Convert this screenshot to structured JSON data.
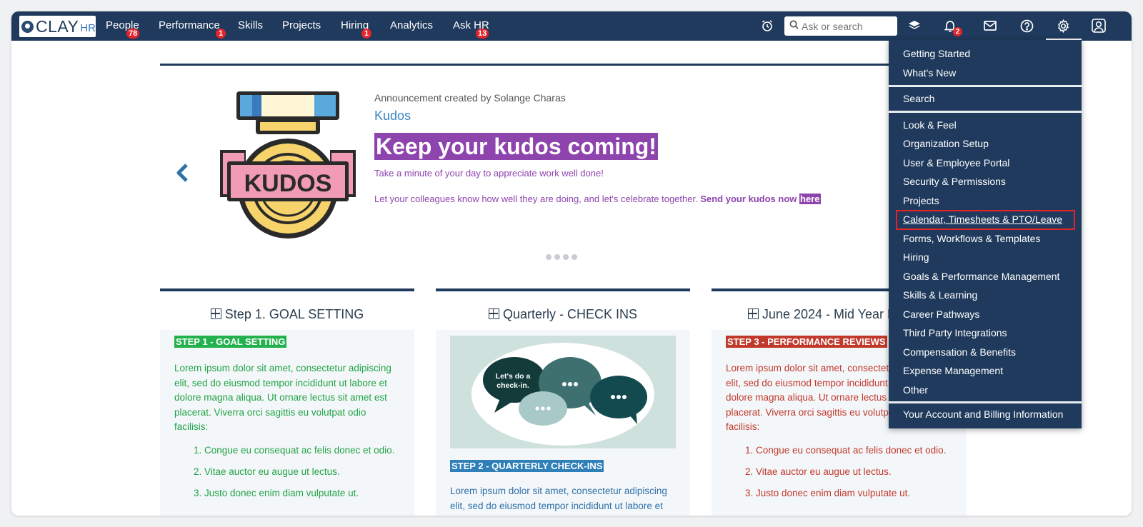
{
  "app": {
    "logo_text": "CLAY",
    "logo_suffix": "HR"
  },
  "nav": {
    "items": [
      {
        "label": "People",
        "badge": "78"
      },
      {
        "label": "Performance",
        "badge": "1"
      },
      {
        "label": "Skills",
        "badge": ""
      },
      {
        "label": "Projects",
        "badge": ""
      },
      {
        "label": "Hiring",
        "badge": "1"
      },
      {
        "label": "Analytics",
        "badge": ""
      },
      {
        "label": "Ask HR",
        "badge": "13"
      }
    ],
    "search_placeholder": "Ask or search",
    "notifications_badge": "2",
    "icons": [
      "alarm-clock-icon",
      "search-icon",
      "layers-icon",
      "bell-icon",
      "mail-icon",
      "help-icon",
      "gear-icon",
      "user-icon"
    ]
  },
  "announcement": {
    "author": "Announcement created by Solange Charas",
    "title": "Kudos",
    "headline": "Keep your kudos coming!",
    "line1": "Take a minute of your day to appreciate work well done!",
    "line2_prefix": "Let your colleagues know how well they are doing, and let's celebrate together. ",
    "line2_bold": "Send your kudos now",
    "line2_link": "here",
    "image_text": "KUDOS",
    "slide_count": 4
  },
  "cards": [
    {
      "title": "Step 1. GOAL SETTING",
      "tag": "STEP 1 -  GOAL SETTING",
      "text": "Lorem ipsum dolor sit amet, consectetur adipiscing elit, sed do eiusmod tempor incididunt ut labore et dolore magna aliqua. Ut ornare lectus sit amet est placerat. Viverra orci sagittis eu volutpat odio facilisis:",
      "list": [
        "Congue eu consequat ac felis donec et odio.",
        "Vitae auctor eu augue ut lectus.",
        "Justo donec enim diam vulputate ut."
      ]
    },
    {
      "title": "Quarterly - CHECK INS",
      "image_text": "Let's do a check-in.",
      "tag": "STEP 2 - QUARTERLY CHECK-INS",
      "text": "Lorem ipsum dolor sit amet, consectetur adipiscing elit, sed do eiusmod tempor incididunt ut labore et"
    },
    {
      "title": "June 2024 - Mid Year Review",
      "tag": "STEP 3 - PERFORMANCE REVIEWS",
      "text": "Lorem ipsum dolor sit amet, consectetur adipiscing elit, sed do eiusmod tempor incididunt ut labore et dolore magna aliqua. Ut ornare lectus sit amet est placerat. Viverra orci sagittis eu volutpat odio facilisis:",
      "list": [
        "Congue eu consequat ac felis donec et odio.",
        "Vitae auctor eu augue ut lectus.",
        "Justo donec enim diam vulputate ut."
      ]
    }
  ],
  "settings_menu": {
    "group1": [
      "Getting Started",
      "What's New"
    ],
    "group2": [
      "Search"
    ],
    "group3": [
      "Look & Feel",
      "Organization Setup",
      "User & Employee Portal",
      "Security & Permissions",
      "Projects",
      "Calendar, Timesheets & PTO/Leave",
      "Forms, Workflows & Templates",
      "Hiring",
      "Goals & Performance Management",
      "Skills & Learning",
      "Career Pathways",
      "Third Party Integrations",
      "Compensation & Benefits",
      "Expense Management",
      "Other"
    ],
    "group4": [
      "Your Account and Billing Information"
    ],
    "highlighted": "Calendar, Timesheets & PTO/Leave"
  },
  "colors": {
    "nav_bg": "#1f3a5c",
    "badge": "#e3242b",
    "accent_purple": "#8e44ad",
    "step1_green": "#22b14c",
    "step2_blue": "#2f80b9",
    "step3_red": "#c0392b"
  }
}
